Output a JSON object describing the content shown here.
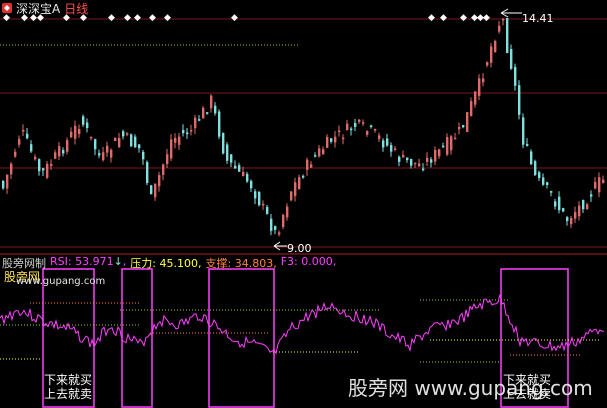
{
  "window": {
    "title_app": "深深宝A",
    "title_period": "日线",
    "colors": {
      "bg": "#000000",
      "up": "#e06a6a",
      "down": "#7fe0e0",
      "grid": "#7a1a1a",
      "divider": "#b02020"
    }
  },
  "main_chart": {
    "high_label": "14.41",
    "low_label": "9.00",
    "marker_glyph": "◆",
    "marker_count": 13
  },
  "indicator": {
    "name": "股旁网制",
    "rsi_label": "RSI:",
    "rsi_value": "53.971",
    "rsi_arrow": "↓",
    "pressure_label": "压力:",
    "pressure_value": "45.100",
    "support_label": "支撑:",
    "support_value": "34.803",
    "f3_label": "F3:",
    "f3_value": "0.000,",
    "colors": {
      "rsi": "#ff40ff",
      "pressure": "#ffff40",
      "support": "#ff8040",
      "box": "#ff40ff"
    }
  },
  "annotations": {
    "brand_small": "股旁网",
    "site_url": "www.gupang.com",
    "box_text_line1": "下来就买",
    "box_text_line2": "上去就卖",
    "box_text_right_line1": "下来就买",
    "box_text_right_line2": "上去就卖"
  },
  "watermark": {
    "text": "股旁网  www.gupang.com"
  },
  "icons": {
    "app_icon": "stock-app-icon"
  }
}
